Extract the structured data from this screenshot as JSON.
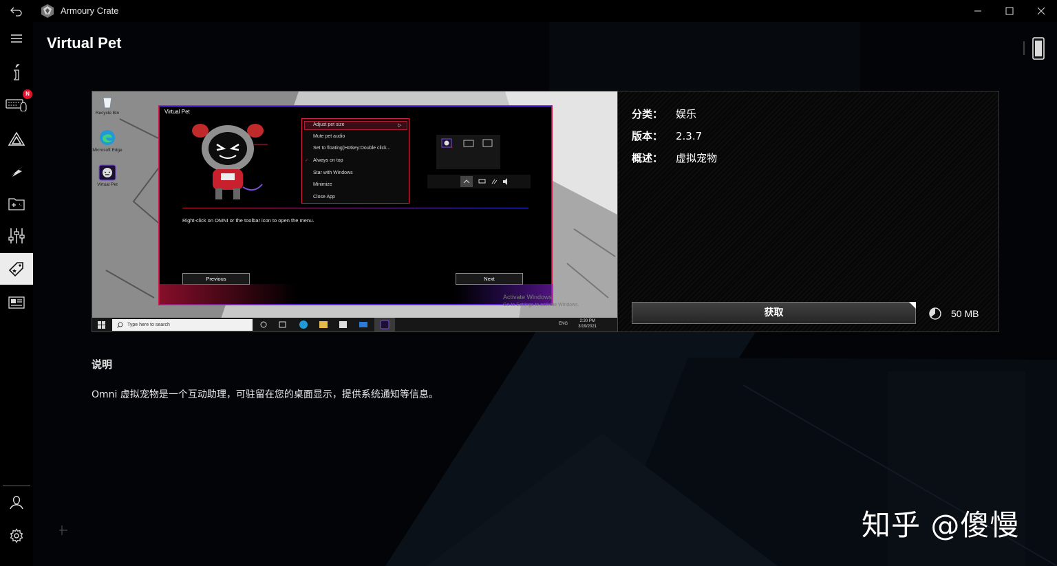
{
  "window": {
    "title": "Armoury Crate"
  },
  "sidebar": {
    "badge": "N",
    "items": [
      {
        "icon": "menu-icon"
      },
      {
        "icon": "info-icon"
      },
      {
        "icon": "keyboard-device-icon"
      },
      {
        "icon": "aura-sync-icon"
      },
      {
        "icon": "rog-eye-icon"
      },
      {
        "icon": "game-library-icon"
      },
      {
        "icon": "settings-sliders-icon"
      },
      {
        "icon": "deals-tag-icon"
      },
      {
        "icon": "news-icon"
      },
      {
        "icon": "user-center-icon"
      },
      {
        "icon": "gear-icon"
      }
    ]
  },
  "page": {
    "title": "Virtual Pet"
  },
  "preview": {
    "desktop_icons": [
      "Recycle Bin",
      "Microsoft Edge",
      "Virtual Pet"
    ],
    "window_title": "Virtual Pet",
    "menu_items": [
      "Adjust pet size",
      "Mute pet audio",
      "Set to floating(Hotkey:Double click...",
      "Always on top",
      "Star with Windows",
      "Minimize",
      "Close App"
    ],
    "hint": "Right-click on OMNI or the toolbar icon to open the menu.",
    "previous": "Previous",
    "next": "Next",
    "activate_title": "Activate Windows",
    "activate_sub": "Go to Settings to activate Windows.",
    "taskbar_search": "Type here to search",
    "lang": "ENG",
    "time": "2:30 PM",
    "date": "3/19/2021"
  },
  "info": {
    "category_label": "分类：",
    "category_value": "娱乐",
    "version_label": "版本：",
    "version_value": "2.3.7",
    "summary_label": "概述：",
    "summary_value": "虚拟宠物",
    "get_button": "获取",
    "size": "50 MB"
  },
  "description": {
    "heading": "说明",
    "text": "Omni 虚拟宠物是一个互动助理，可驻留在您的桌面显示，提供系统通知等信息。"
  },
  "watermark": "知乎 @傻慢",
  "colors": {
    "accent_red": "#e0224a",
    "accent_purple": "#5a1fd8",
    "badge_red": "#e0112b"
  }
}
